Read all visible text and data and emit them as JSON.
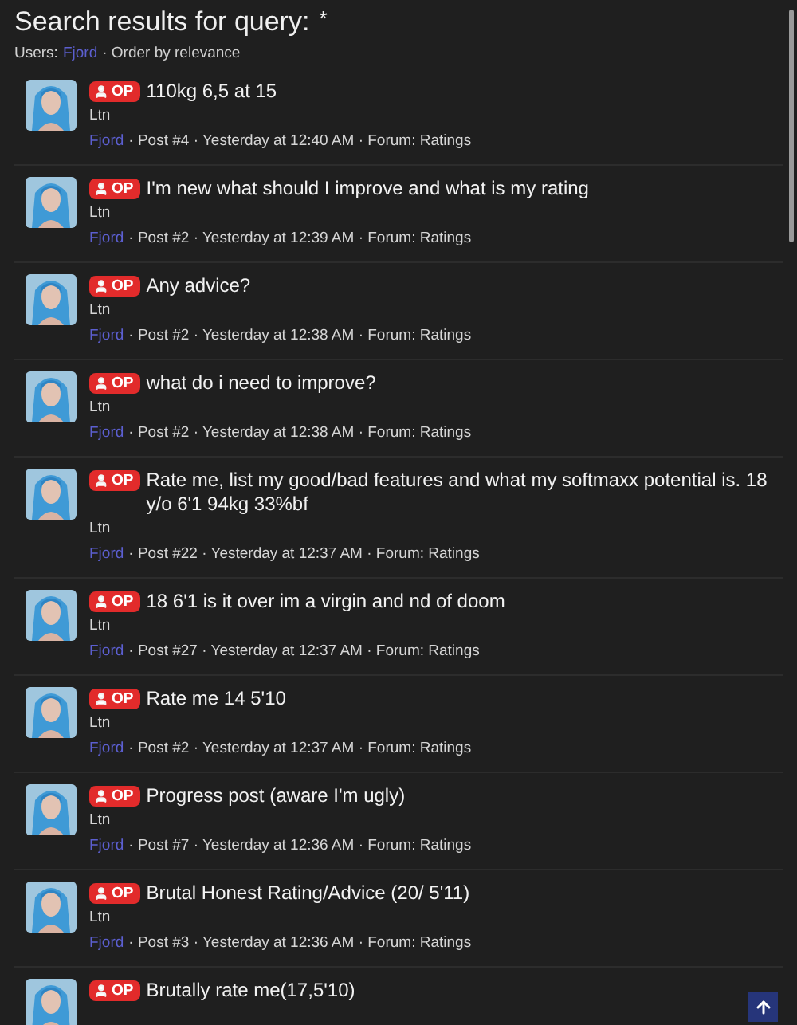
{
  "title": "Search results for query:",
  "query": "*",
  "filter": {
    "label": "Users:",
    "user": "Fjord",
    "order": "· Order by relevance"
  },
  "results": [
    {
      "badge": "OP",
      "title": "110kg 6,5 at 15",
      "snippet": "Ltn",
      "user": "Fjord",
      "details": "· Post #4 · Yesterday at 12:40 AM · Forum: Ratings"
    },
    {
      "badge": "OP",
      "title": "I'm new what should I improve and what is my rating",
      "snippet": "Ltn",
      "user": "Fjord",
      "details": "· Post #2 · Yesterday at 12:39 AM · Forum: Ratings"
    },
    {
      "badge": "OP",
      "title": "Any advice?",
      "snippet": "Ltn",
      "user": "Fjord",
      "details": "· Post #2 · Yesterday at 12:38 AM · Forum: Ratings"
    },
    {
      "badge": "OP",
      "title": "what do i need to improve?",
      "snippet": "Ltn",
      "user": "Fjord",
      "details": "· Post #2 · Yesterday at 12:38 AM · Forum: Ratings"
    },
    {
      "badge": "OP",
      "title": "Rate me, list my good/bad features and what my softmaxx potential is. 18 y/o 6'1 94kg 33%bf",
      "snippet": "Ltn",
      "user": "Fjord",
      "details": "· Post #22 · Yesterday at 12:37 AM · Forum: Ratings"
    },
    {
      "badge": "OP",
      "title": "18 6'1 is it over im a virgin and nd of doom",
      "snippet": "Ltn",
      "user": "Fjord",
      "details": "· Post #27 · Yesterday at 12:37 AM · Forum: Ratings"
    },
    {
      "badge": "OP",
      "title": "Rate me 14 5'10",
      "snippet": "Ltn",
      "user": "Fjord",
      "details": "· Post #2 · Yesterday at 12:37 AM · Forum: Ratings"
    },
    {
      "badge": "OP",
      "title": "Progress post (aware I'm ugly)",
      "snippet": "Ltn",
      "user": "Fjord",
      "details": "· Post #7 · Yesterday at 12:36 AM · Forum: Ratings"
    },
    {
      "badge": "OP",
      "title": "Brutal Honest Rating/Advice (20/ 5'11)",
      "snippet": "Ltn",
      "user": "Fjord",
      "details": "· Post #3 · Yesterday at 12:36 AM · Forum: Ratings"
    },
    {
      "badge": "OP",
      "title": "Brutally rate me(17,5'10)"
    }
  ]
}
